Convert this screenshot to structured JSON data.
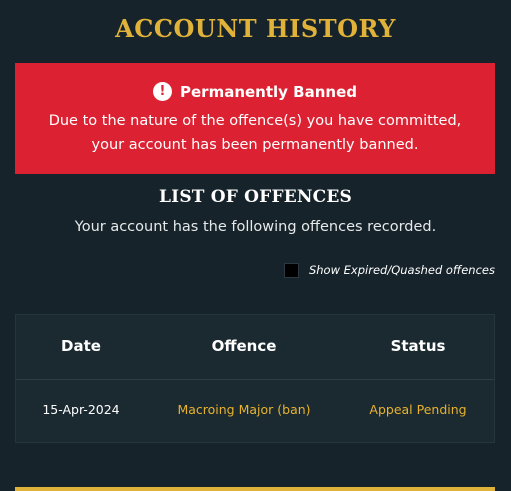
{
  "page": {
    "title": "ACCOUNT HISTORY"
  },
  "ban_alert": {
    "icon": "exclamation-icon",
    "icon_glyph": "!",
    "heading": "Permanently Banned",
    "line1": "Due to the nature of the offence(s) you have committed,",
    "line2": "your account has been permanently banned.",
    "background_color": "#dc2232"
  },
  "offences": {
    "title": "LIST OF OFFENCES",
    "subtitle": "Your account has the following offences recorded.",
    "show_expired_label": "Show Expired/Quashed offences",
    "show_expired_checked": false
  },
  "table": {
    "columns": [
      "Date",
      "Offence",
      "Status"
    ],
    "rows": [
      {
        "date": "15-Apr-2024",
        "offence": "Macroing Major (ban)",
        "status": "Appeal Pending"
      }
    ]
  },
  "colors": {
    "accent_gold": "#e0b23a",
    "background": "#16232a",
    "highlight_text": "#e8b22e"
  }
}
